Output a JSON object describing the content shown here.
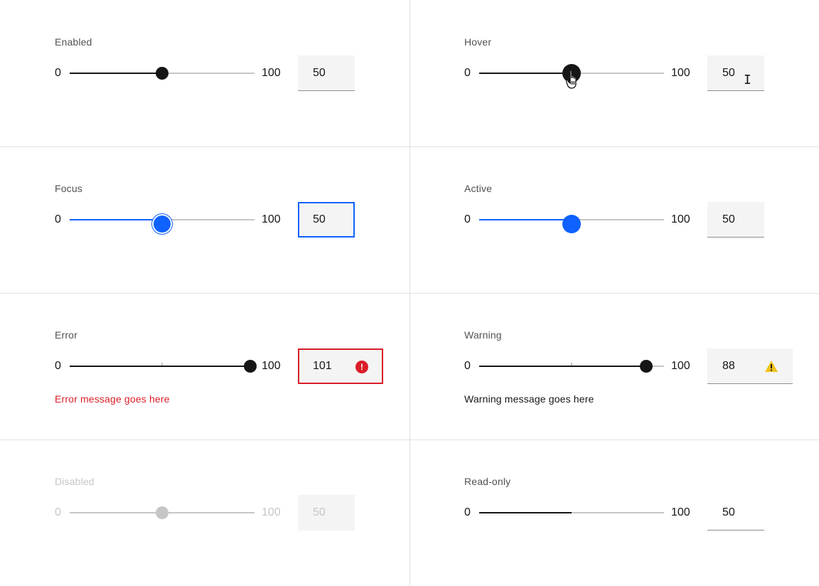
{
  "states": [
    {
      "key": "enabled",
      "label": "Enabled",
      "min": "0",
      "max": "100",
      "value": "50",
      "value_fraction": 0.5,
      "input": "50"
    },
    {
      "key": "hover",
      "label": "Hover",
      "min": "0",
      "max": "100",
      "value": "50",
      "value_fraction": 0.5,
      "input": "50"
    },
    {
      "key": "focus",
      "label": "Focus",
      "min": "0",
      "max": "100",
      "value": "50",
      "value_fraction": 0.5,
      "input": "50"
    },
    {
      "key": "active",
      "label": "Active",
      "min": "0",
      "max": "100",
      "value": "50",
      "value_fraction": 0.5,
      "input": "50"
    },
    {
      "key": "error",
      "label": "Error",
      "min": "0",
      "max": "100",
      "value": "101",
      "value_fraction": 1.0,
      "input": "101",
      "message": "Error message goes here",
      "icon": "error-icon"
    },
    {
      "key": "warning",
      "label": "Warning",
      "min": "0",
      "max": "100",
      "value": "88",
      "value_fraction": 0.88,
      "input": "88",
      "message": "Warning message goes here",
      "icon": "warning-icon"
    },
    {
      "key": "disabled",
      "label": "Disabled",
      "min": "0",
      "max": "100",
      "value": "50",
      "value_fraction": 0.5,
      "input": "50"
    },
    {
      "key": "readonly",
      "label": "Read-only",
      "min": "0",
      "max": "100",
      "value": "50",
      "value_fraction": 0.5,
      "input": "50"
    }
  ],
  "colors": {
    "text": "#161616",
    "label": "#525252",
    "track": "#c6c6c6",
    "fill": "#161616",
    "focus": "#0f62fe",
    "error": "#da1e28",
    "warning": "#f1c21b",
    "field": "#f4f4f4",
    "disabled": "#c6c6c6"
  }
}
